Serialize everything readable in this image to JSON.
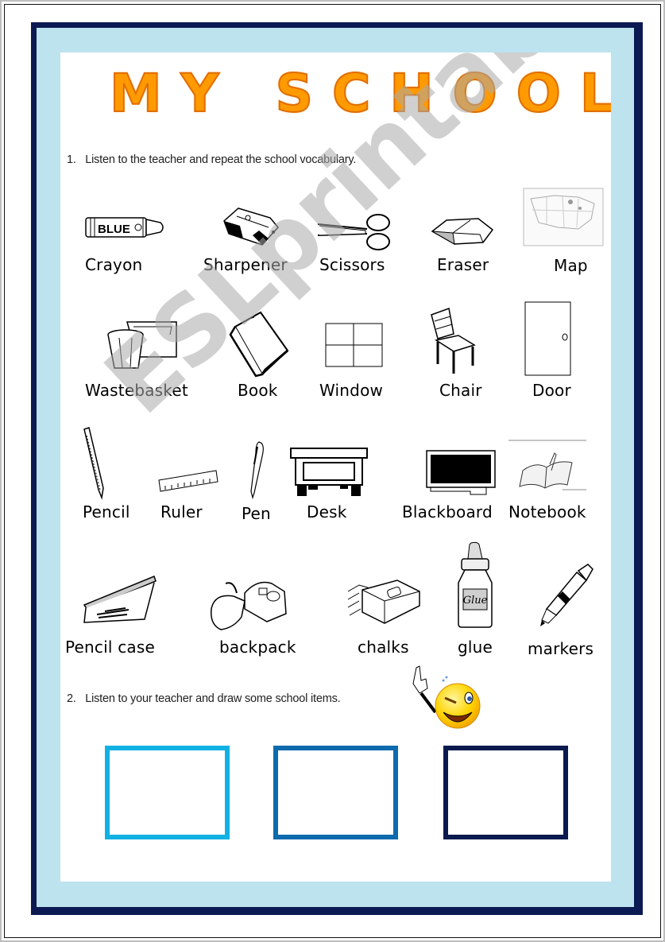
{
  "worksheet": {
    "title": "MY SCHOOL",
    "watermark": "ESLprintables.com",
    "exercise1": {
      "number": "1.",
      "instruction": "Listen to the teacher and repeat the school vocabulary."
    },
    "vocabulary": [
      {
        "label": "Crayon",
        "icon": "crayon-icon"
      },
      {
        "label": "Sharpener",
        "icon": "sharpener-icon"
      },
      {
        "label": "Scissors",
        "icon": "scissors-icon"
      },
      {
        "label": "Eraser",
        "icon": "eraser-icon"
      },
      {
        "label": "Map",
        "icon": "map-icon"
      },
      {
        "label": "Wastebasket",
        "icon": "wastebasket-icon"
      },
      {
        "label": "Book",
        "icon": "book-icon"
      },
      {
        "label": "Window",
        "icon": "window-icon"
      },
      {
        "label": "Chair",
        "icon": "chair-icon"
      },
      {
        "label": "Door",
        "icon": "door-icon"
      },
      {
        "label": "Pencil",
        "icon": "pencil-icon"
      },
      {
        "label": "Ruler",
        "icon": "ruler-icon"
      },
      {
        "label": "Pen",
        "icon": "pen-icon"
      },
      {
        "label": "Desk",
        "icon": "desk-icon"
      },
      {
        "label": "Blackboard",
        "icon": "blackboard-icon"
      },
      {
        "label": "Notebook",
        "icon": "notebook-icon"
      },
      {
        "label": "Pencil case",
        "icon": "pencil-case-icon"
      },
      {
        "label": "backpack",
        "icon": "backpack-icon"
      },
      {
        "label": "chalks",
        "icon": "chalks-icon"
      },
      {
        "label": "glue",
        "icon": "glue-icon"
      },
      {
        "label": "markers",
        "icon": "markers-icon"
      }
    ],
    "crayon_text": "BLUE",
    "glue_text": "Glue",
    "exercise2": {
      "number": "2.",
      "instruction": "Listen to your teacher and draw some school items.",
      "drawing_boxes": [
        {
          "color": "#12b1e3"
        },
        {
          "color": "#0d6aad"
        },
        {
          "color": "#0a1a4f"
        }
      ]
    },
    "colors": {
      "title_fill": "#ff9a00",
      "title_outline": "#e06d00",
      "frame_navy": "#0b1a52",
      "frame_light_blue": "#bde3ee"
    }
  }
}
